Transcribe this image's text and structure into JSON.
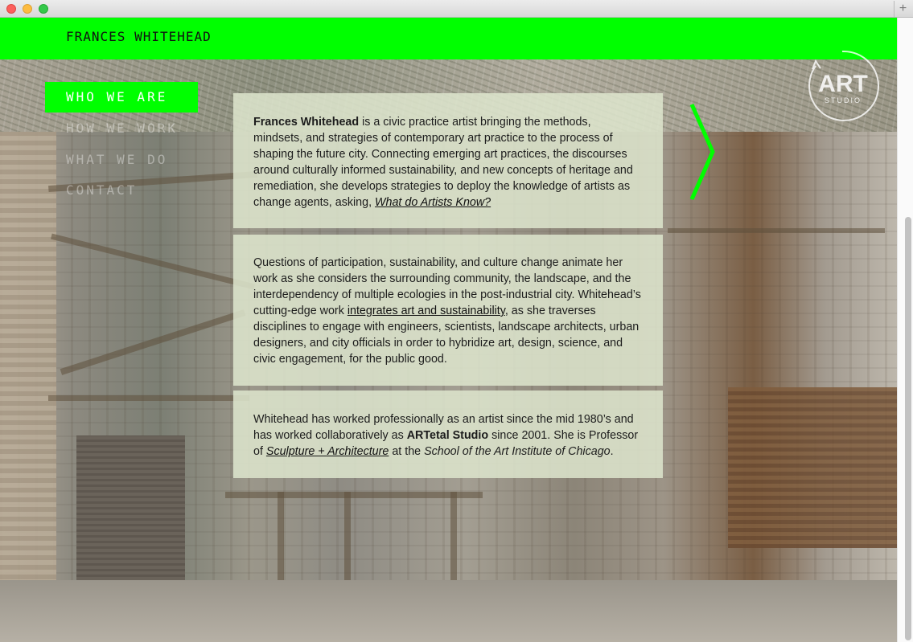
{
  "header": {
    "title": "FRANCES WHITEHEAD"
  },
  "logo": {
    "text_main": "ART",
    "text_sub": "STUDIO"
  },
  "nav": {
    "items": [
      {
        "label": "WHO WE ARE",
        "active": true
      },
      {
        "label": "HOW WE WORK",
        "active": false
      },
      {
        "label": "WHAT WE DO",
        "active": false
      },
      {
        "label": "CONTACT",
        "active": false
      }
    ]
  },
  "panels": {
    "p1": {
      "name": "Frances Whitehead",
      "text1": " is a civic practice artist bringing the methods, mindsets, and strategies of contemporary art practice to the process of shaping the future city. Connecting emerging art practices, the discourses around culturally informed sustainability, and new concepts of heritage and remediation, she develops strategies to deploy the knowledge of artists as change agents, asking, ",
      "link": "What do Artists Know?"
    },
    "p2": {
      "text1": "Questions of participation, sustainability, and culture change animate her work as she considers the surrounding community, the landscape, and the interdependency of multiple ecologies in the post-industrial city. Whitehead’s cutting-edge work ",
      "link": "integrates art and sustainability",
      "text2": ", as she traverses disciplines to engage with engineers, scientists, landscape architects, urban designers, and city officials in order to hybridize art, design, science, and civic engagement, for the public good."
    },
    "p3": {
      "text1": "Whitehead has worked professionally as an artist since the mid 1980’s and has worked collaboratively as ",
      "studio": "ARTetal Studio",
      "text2": " since 2001. She is Professor of ",
      "link": "Sculpture + Architecture",
      "text3": " at the ",
      "school": "School of the Art Institute of Chicago",
      "text4": "."
    }
  },
  "colors": {
    "accent": "#00ff00",
    "panel_bg": "#dde5cd"
  },
  "icons": {
    "next": "chevron-right-icon",
    "new_tab": "plus-icon"
  },
  "chrome": {
    "new_tab_symbol": "+"
  }
}
